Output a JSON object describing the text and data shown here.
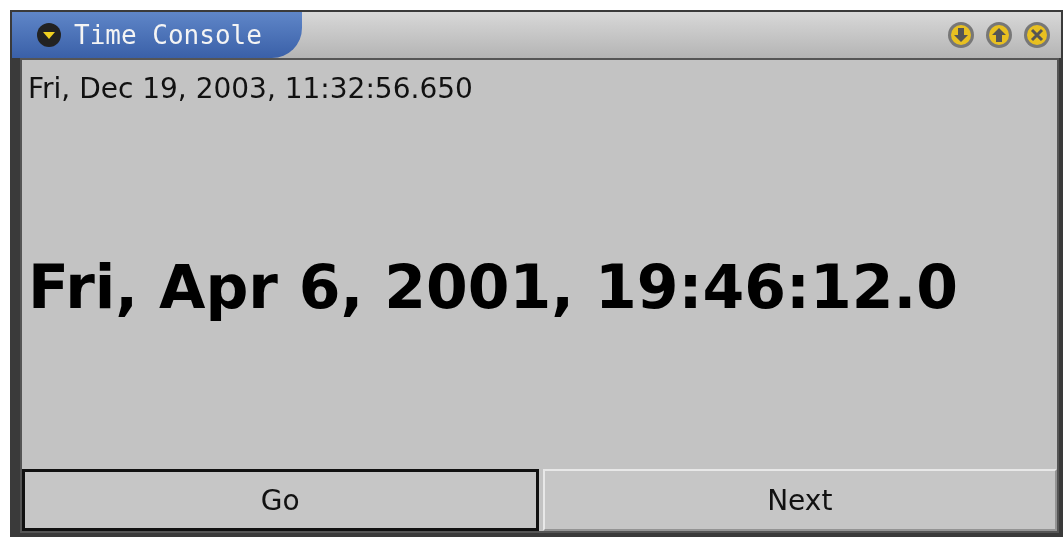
{
  "window": {
    "title": "Time Console"
  },
  "current_time": "Fri, Dec 19, 2003, 11:32:56.650",
  "display_time": "Fri, Apr 6, 2001, 19:46:12.0",
  "buttons": [
    {
      "label": "Go",
      "focused": true
    },
    {
      "label": "Next",
      "focused": false
    }
  ]
}
